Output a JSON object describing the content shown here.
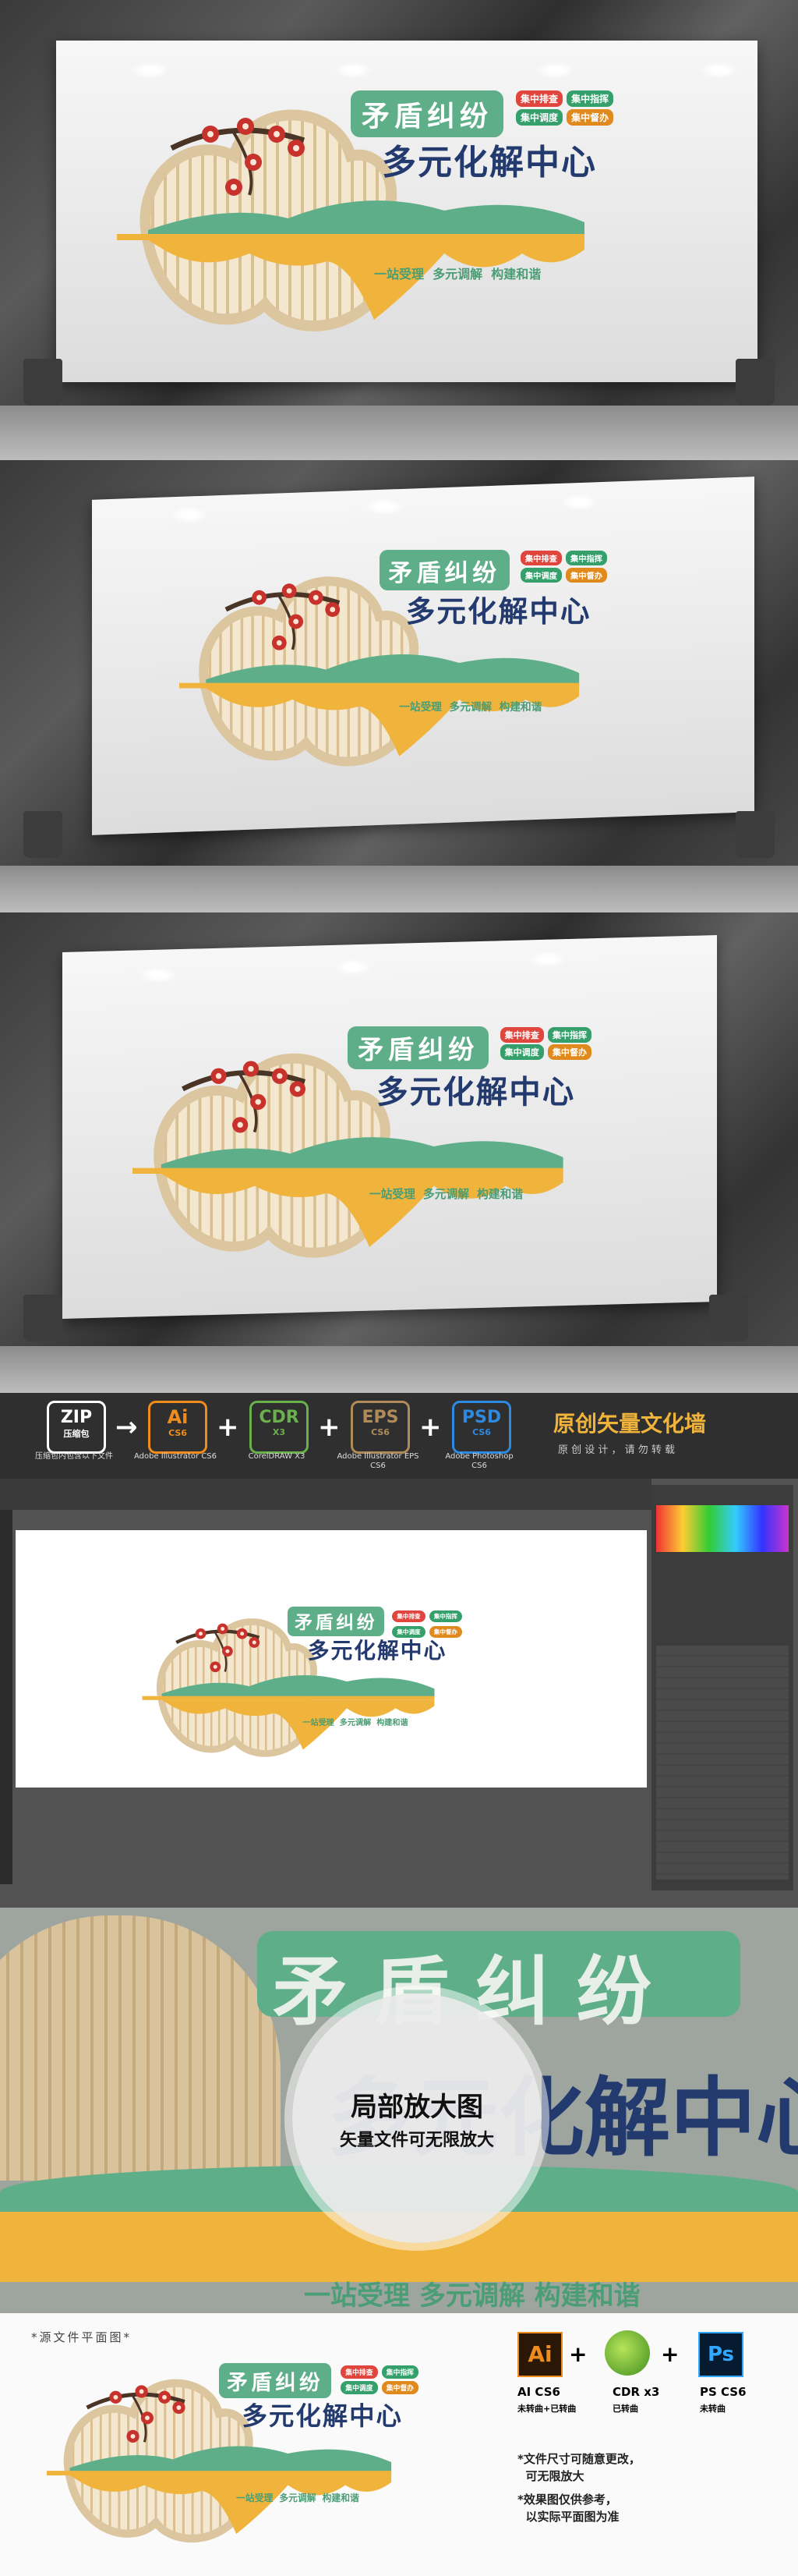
{
  "design": {
    "title_main": "矛盾纠纷",
    "title_sub": "多元化解中心",
    "tags": [
      "集中排查",
      "集中指挥",
      "集中调度",
      "集中督办"
    ],
    "slogan": "一站受理  多元调解  构建和谐",
    "colors": {
      "green": "#5fae8a",
      "navy": "#233a6e",
      "orange": "#f0b43c",
      "beige": "#dcc6a0",
      "red": "#c8322c"
    }
  },
  "formats": {
    "zip": {
      "label": "ZIP",
      "caption": "压缩包",
      "note": "压缩包内包含以下文件"
    },
    "items": [
      {
        "badge": "Ai",
        "ver": "CS6",
        "label": "Adobe Illustrator CS6",
        "color": "#f08c1e"
      },
      {
        "badge": "CDR",
        "ver": "X3",
        "label": "CorelDRAW X3",
        "color": "#6ab04c"
      },
      {
        "badge": "EPS",
        "ver": "CS6",
        "label": "Adobe Illustrator EPS CS6",
        "color": "#b08b5a"
      },
      {
        "badge": "PSD",
        "ver": "CS6",
        "label": "Adobe Photoshop CS6",
        "color": "#2d8ae0"
      }
    ],
    "plus": "+",
    "arrow": "→",
    "brand_title": "原创矢量文化墙",
    "brand_sub": "原 创 设 计 ， 请 勿 转 载"
  },
  "zoom": {
    "title": "局部放大图",
    "sub": "矢量文件可无限放大"
  },
  "bottom": {
    "heading": "*源文件平面图*",
    "files": [
      {
        "badge": "Ai",
        "name": "AI CS6",
        "desc": "未转曲+已转曲"
      },
      {
        "badge": "CDR",
        "name": "CDR x3",
        "desc": "已转曲"
      },
      {
        "badge": "Ps",
        "name": "PS CS6",
        "desc": "未转曲"
      }
    ],
    "notes": [
      "*文件尺寸可随意更改，",
      "  可无限放大",
      "*效果图仅供参考，",
      "  以实际平面图为准"
    ]
  }
}
